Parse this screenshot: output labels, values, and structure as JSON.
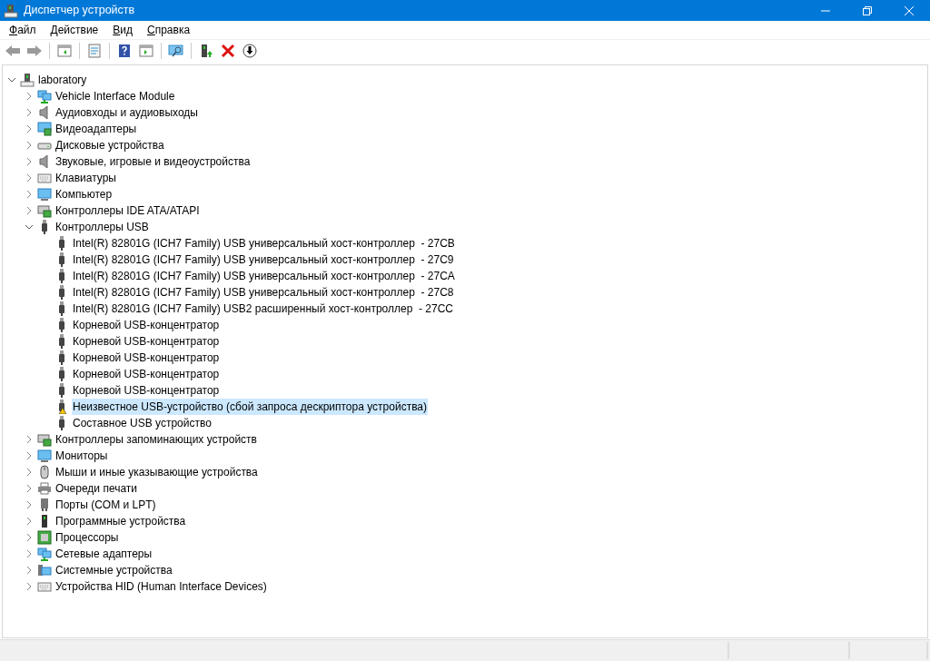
{
  "window": {
    "title": "Диспетчер устройств"
  },
  "menu": [
    "Файл",
    "Действие",
    "Вид",
    "Справка"
  ],
  "tree": {
    "label": "laboratory",
    "kind": "computer-root",
    "expanded": true,
    "selected": false,
    "children": [
      {
        "label": "Vehicle Interface Module",
        "kind": "network",
        "expanded": false,
        "selected": false
      },
      {
        "label": "Аудиовходы и аудиовыходы",
        "kind": "audio",
        "expanded": false,
        "selected": false
      },
      {
        "label": "Видеоадаптеры",
        "kind": "display",
        "expanded": false,
        "selected": false
      },
      {
        "label": "Дисковые устройства",
        "kind": "disk",
        "expanded": false,
        "selected": false
      },
      {
        "label": "Звуковые, игровые и видеоустройства",
        "kind": "audio",
        "expanded": false,
        "selected": false
      },
      {
        "label": "Клавиатуры",
        "kind": "keyboard",
        "expanded": false,
        "selected": false
      },
      {
        "label": "Компьютер",
        "kind": "monitor",
        "expanded": false,
        "selected": false
      },
      {
        "label": "Контроллеры IDE ATA/ATAPI",
        "kind": "controller",
        "expanded": false,
        "selected": false
      },
      {
        "label": "Контроллеры USB",
        "kind": "usb",
        "expanded": true,
        "selected": false,
        "children": [
          {
            "label": "Intel(R) 82801G (ICH7 Family) USB универсальный хост-контроллер  - 27CB",
            "kind": "usb",
            "selected": false,
            "warning": false
          },
          {
            "label": "Intel(R) 82801G (ICH7 Family) USB универсальный хост-контроллер  - 27C9",
            "kind": "usb",
            "selected": false,
            "warning": false
          },
          {
            "label": "Intel(R) 82801G (ICH7 Family) USB универсальный хост-контроллер  - 27CA",
            "kind": "usb",
            "selected": false,
            "warning": false
          },
          {
            "label": "Intel(R) 82801G (ICH7 Family) USB универсальный хост-контроллер  - 27C8",
            "kind": "usb",
            "selected": false,
            "warning": false
          },
          {
            "label": "Intel(R) 82801G (ICH7 Family) USB2 расширенный хост-контроллер  - 27CC",
            "kind": "usb",
            "selected": false,
            "warning": false
          },
          {
            "label": "Корневой USB-концентратор",
            "kind": "usb",
            "selected": false,
            "warning": false
          },
          {
            "label": "Корневой USB-концентратор",
            "kind": "usb",
            "selected": false,
            "warning": false
          },
          {
            "label": "Корневой USB-концентратор",
            "kind": "usb",
            "selected": false,
            "warning": false
          },
          {
            "label": "Корневой USB-концентратор",
            "kind": "usb",
            "selected": false,
            "warning": false
          },
          {
            "label": "Корневой USB-концентратор",
            "kind": "usb",
            "selected": false,
            "warning": false
          },
          {
            "label": "Неизвестное USB-устройство (сбой запроса дескриптора устройства)",
            "kind": "usb",
            "selected": true,
            "warning": true
          },
          {
            "label": "Составное USB устройство",
            "kind": "usb",
            "selected": false,
            "warning": false
          }
        ]
      },
      {
        "label": "Контроллеры запоминающих устройств",
        "kind": "controller",
        "expanded": false,
        "selected": false
      },
      {
        "label": "Мониторы",
        "kind": "monitor",
        "expanded": false,
        "selected": false
      },
      {
        "label": "Мыши и иные указывающие устройства",
        "kind": "mouse",
        "expanded": false,
        "selected": false
      },
      {
        "label": "Очереди печати",
        "kind": "printer",
        "expanded": false,
        "selected": false
      },
      {
        "label": "Порты (COM и LPT)",
        "kind": "port",
        "expanded": false,
        "selected": false
      },
      {
        "label": "Программные устройства",
        "kind": "software",
        "expanded": false,
        "selected": false
      },
      {
        "label": "Процессоры",
        "kind": "cpu",
        "expanded": false,
        "selected": false
      },
      {
        "label": "Сетевые адаптеры",
        "kind": "network",
        "expanded": false,
        "selected": false
      },
      {
        "label": "Системные устройства",
        "kind": "system",
        "expanded": false,
        "selected": false
      },
      {
        "label": "Устройства HID (Human Interface Devices)",
        "kind": "keyboard",
        "expanded": false,
        "selected": false
      }
    ]
  }
}
